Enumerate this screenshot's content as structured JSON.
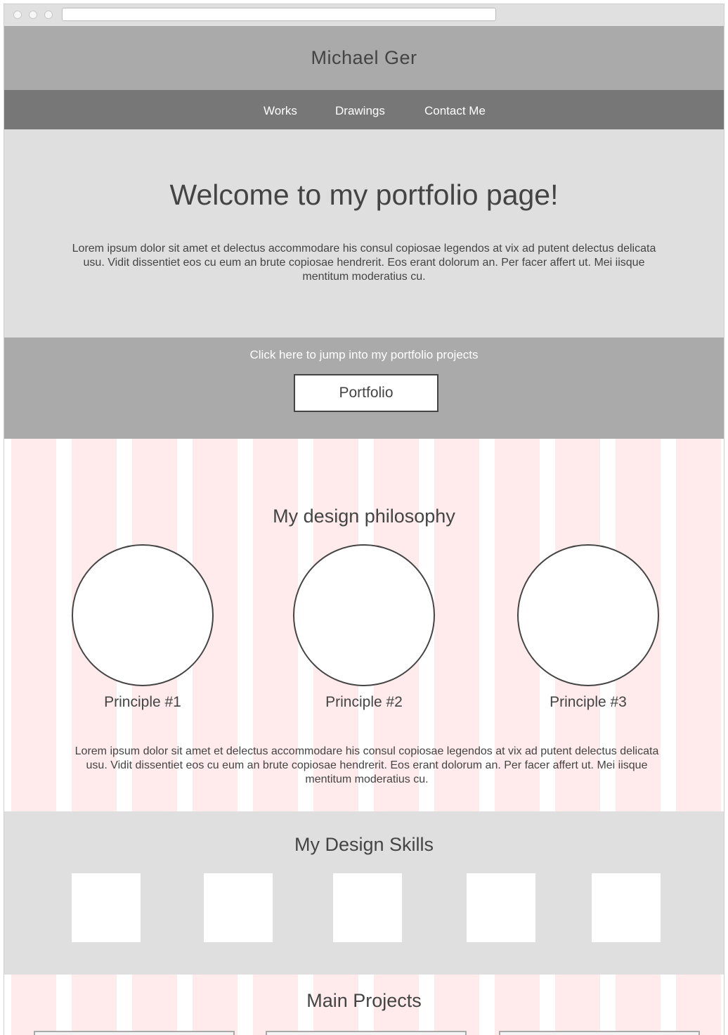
{
  "header": {
    "title": "Michael Ger"
  },
  "nav": {
    "items": [
      {
        "label": "Works"
      },
      {
        "label": "Drawings"
      },
      {
        "label": "Contact Me"
      }
    ]
  },
  "hero": {
    "title": "Welcome to my portfolio page!",
    "text": "Lorem ipsum dolor sit amet et delectus accommodare his consul copiosae legendos at vix ad putent delectus delicata usu. Vidit dissentiet eos cu eum an brute copiosae hendrerit. Eos erant dolorum an. Per facer affert ut. Mei iisque mentitum moderatius cu."
  },
  "cta": {
    "text": "Click here to jump into my portfolio projects",
    "button_label": "Portfolio"
  },
  "philosophy": {
    "title": "My design philosophy",
    "principles": [
      {
        "label": "Principle #1"
      },
      {
        "label": "Principle #2"
      },
      {
        "label": "Principle #3"
      }
    ],
    "text": "Lorem ipsum dolor sit amet et delectus accommodare his consul copiosae legendos at vix ad putent delectus delicata usu. Vidit dissentiet eos cu eum an brute copiosae hendrerit. Eos erant dolorum an. Per facer affert ut. Mei iisque mentitum moderatius cu."
  },
  "skills": {
    "title": "My Design Skills"
  },
  "projects": {
    "title": "Main Projects"
  },
  "colors": {
    "header_bg": "#aaaaaa",
    "nav_bg": "#777777",
    "hero_bg": "#dfdfdf",
    "stripe_pink": "#ffebeb",
    "text": "#444444"
  }
}
